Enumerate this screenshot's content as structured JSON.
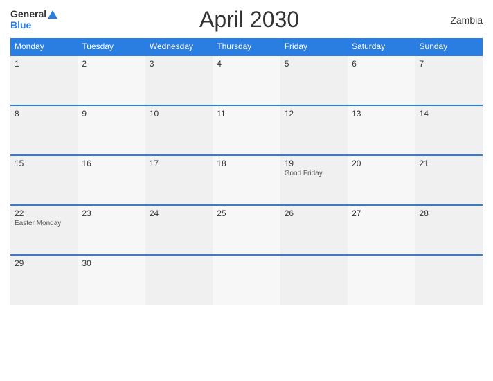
{
  "header": {
    "logo_general": "General",
    "logo_blue": "Blue",
    "title": "April 2030",
    "country": "Zambia"
  },
  "calendar": {
    "days_of_week": [
      "Monday",
      "Tuesday",
      "Wednesday",
      "Thursday",
      "Friday",
      "Saturday",
      "Sunday"
    ],
    "weeks": [
      [
        {
          "num": "1",
          "holiday": ""
        },
        {
          "num": "2",
          "holiday": ""
        },
        {
          "num": "3",
          "holiday": ""
        },
        {
          "num": "4",
          "holiday": ""
        },
        {
          "num": "5",
          "holiday": ""
        },
        {
          "num": "6",
          "holiday": ""
        },
        {
          "num": "7",
          "holiday": ""
        }
      ],
      [
        {
          "num": "8",
          "holiday": ""
        },
        {
          "num": "9",
          "holiday": ""
        },
        {
          "num": "10",
          "holiday": ""
        },
        {
          "num": "11",
          "holiday": ""
        },
        {
          "num": "12",
          "holiday": ""
        },
        {
          "num": "13",
          "holiday": ""
        },
        {
          "num": "14",
          "holiday": ""
        }
      ],
      [
        {
          "num": "15",
          "holiday": ""
        },
        {
          "num": "16",
          "holiday": ""
        },
        {
          "num": "17",
          "holiday": ""
        },
        {
          "num": "18",
          "holiday": ""
        },
        {
          "num": "19",
          "holiday": "Good Friday"
        },
        {
          "num": "20",
          "holiday": ""
        },
        {
          "num": "21",
          "holiday": ""
        }
      ],
      [
        {
          "num": "22",
          "holiday": "Easter Monday"
        },
        {
          "num": "23",
          "holiday": ""
        },
        {
          "num": "24",
          "holiday": ""
        },
        {
          "num": "25",
          "holiday": ""
        },
        {
          "num": "26",
          "holiday": ""
        },
        {
          "num": "27",
          "holiday": ""
        },
        {
          "num": "28",
          "holiday": ""
        }
      ],
      [
        {
          "num": "29",
          "holiday": ""
        },
        {
          "num": "30",
          "holiday": ""
        },
        {
          "num": "",
          "holiday": ""
        },
        {
          "num": "",
          "holiday": ""
        },
        {
          "num": "",
          "holiday": ""
        },
        {
          "num": "",
          "holiday": ""
        },
        {
          "num": "",
          "holiday": ""
        }
      ]
    ]
  }
}
